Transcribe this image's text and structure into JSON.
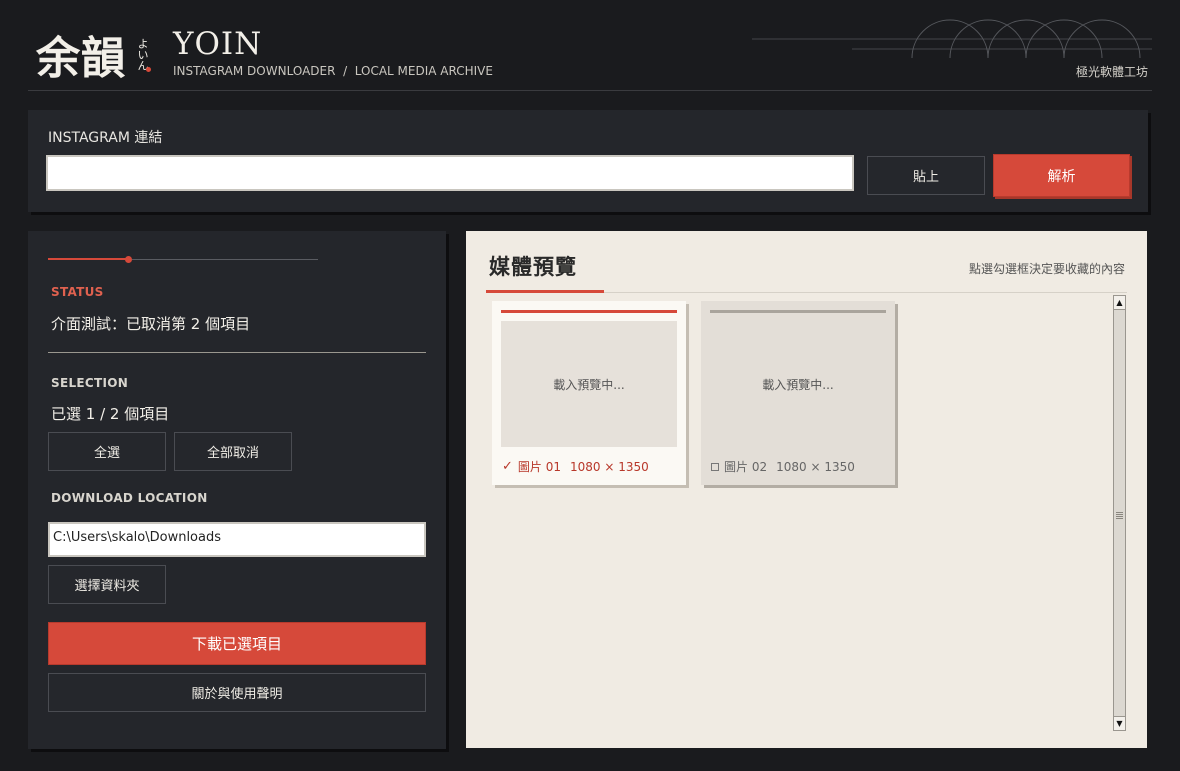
{
  "header": {
    "logo_kanji": "余韻",
    "logo_kana": "よいん",
    "brand": "YOIN",
    "subtitle": "INSTAGRAM DOWNLOADER  /  LOCAL MEDIA ARCHIVE",
    "studio": "極光軟體工坊"
  },
  "url_panel": {
    "label": "INSTAGRAM 連結",
    "url_value": "",
    "paste_label": "貼上",
    "parse_label": "解析"
  },
  "left": {
    "status_label": "STATUS",
    "status_text": "介面測試：已取消第 2 個項目",
    "selection_label": "SELECTION",
    "selection_text": "已選 1 / 2 個項目",
    "select_all": "全選",
    "deselect_all": "全部取消",
    "download_label": "DOWNLOAD LOCATION",
    "path": "C:\\Users\\skalo\\Downloads",
    "choose_folder": "選擇資料夾",
    "download_button": "下載已選項目",
    "about_button": "關於與使用聲明"
  },
  "preview": {
    "title": "媒體預覽",
    "hint": "點選勾選框決定要收藏的內容",
    "items": [
      {
        "loading": "載入預覽中...",
        "name": "圖片 01",
        "size": "1080 × 1350",
        "checked": true
      },
      {
        "loading": "載入預覽中...",
        "name": "圖片 02",
        "size": "1080 × 1350",
        "checked": false
      }
    ]
  },
  "colors": {
    "accent": "#d6493a",
    "background": "#1a1b1e",
    "panel": "#24262b",
    "preview_bg": "#f0ebe3"
  }
}
